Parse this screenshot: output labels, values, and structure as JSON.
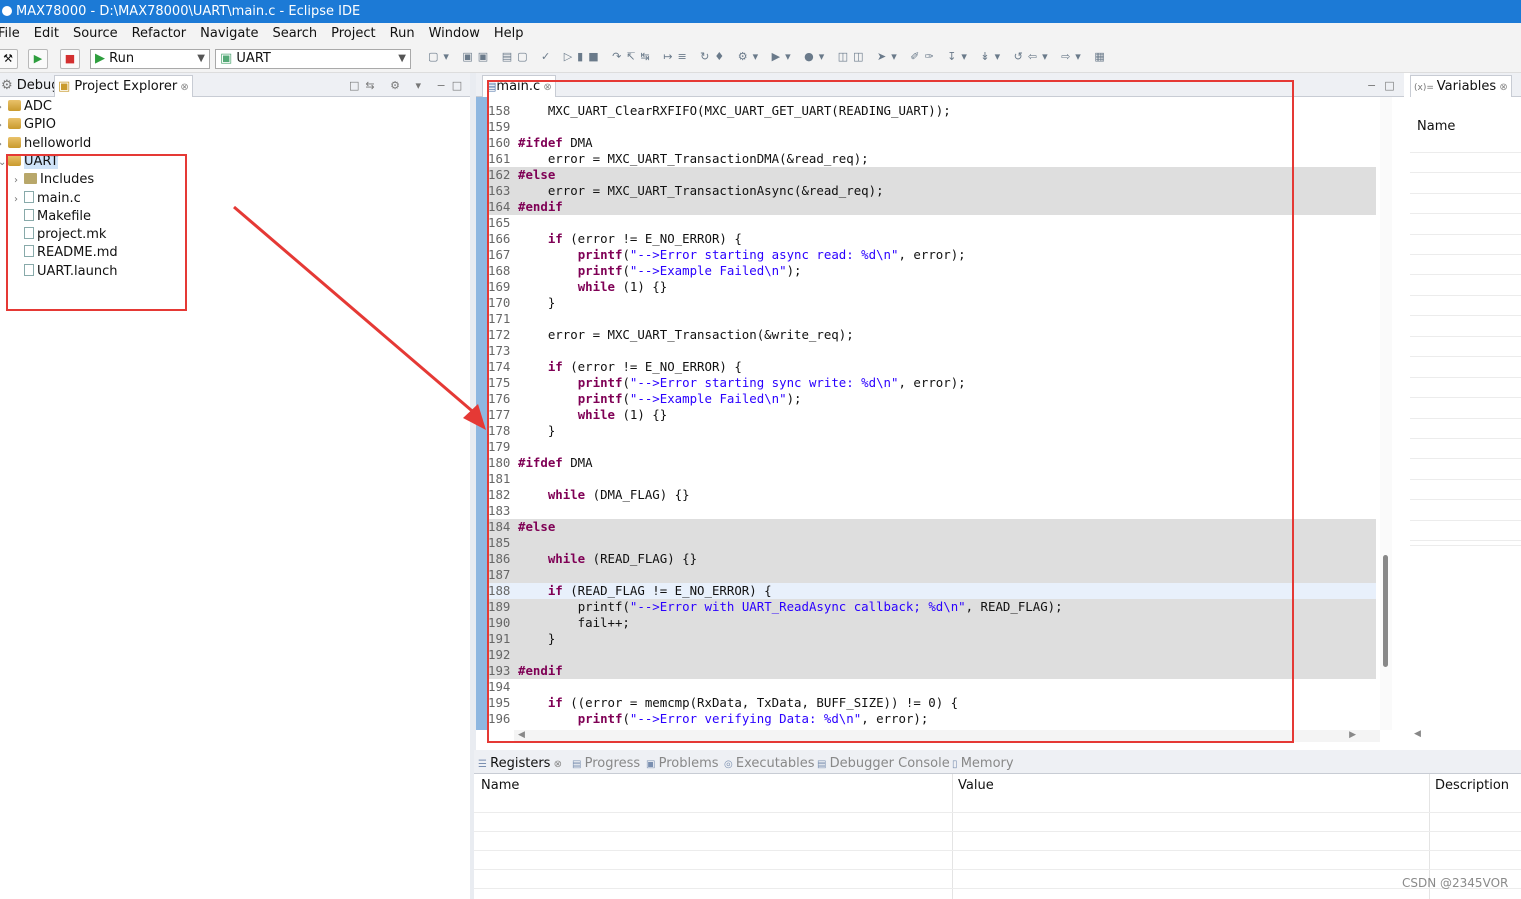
{
  "window": {
    "title": "MAX78000 - D:\\MAX78000\\UART\\main.c - Eclipse IDE"
  },
  "menu": [
    "File",
    "Edit",
    "Source",
    "Refactor",
    "Navigate",
    "Search",
    "Project",
    "Run",
    "Window",
    "Help"
  ],
  "toolbar": {
    "launch_mode": "Run",
    "launch_config": "UART"
  },
  "left_tabs": {
    "debug": "Debug",
    "project_explorer": "Project Explorer"
  },
  "tree": [
    {
      "label": "ADC",
      "icon": "project-folder-icon",
      "expanded": false
    },
    {
      "label": "GPIO",
      "icon": "project-folder-icon",
      "expanded": false
    },
    {
      "label": "helloworld",
      "icon": "project-folder-icon",
      "expanded": false
    },
    {
      "label": "UART",
      "icon": "project-folder-icon",
      "expanded": true,
      "selected": true
    },
    {
      "label": "Includes",
      "icon": "includes-icon",
      "child": true
    },
    {
      "label": "main.c",
      "icon": "c-file-icon",
      "child": true
    },
    {
      "label": "Makefile",
      "icon": "makefile-icon",
      "child": true
    },
    {
      "label": "project.mk",
      "icon": "file-icon",
      "child": true
    },
    {
      "label": "README.md",
      "icon": "file-icon",
      "child": true
    },
    {
      "label": "UART.launch",
      "icon": "file-icon",
      "child": true
    }
  ],
  "editor": {
    "tab": "main.c",
    "lines": [
      {
        "n": "158",
        "bg": "",
        "text": "    MXC_UART_ClearRXFIFO(MXC_UART_GET_UART(READING_UART));"
      },
      {
        "n": "159",
        "bg": "",
        "text": ""
      },
      {
        "n": "160",
        "bg": "",
        "text": "#ifdef DMA",
        "pre": "#ifdef",
        "rest": " DMA"
      },
      {
        "n": "161",
        "bg": "",
        "text": "    error = MXC_UART_TransactionDMA(&read_req);"
      },
      {
        "n": "162",
        "bg": "grey",
        "text": "#else",
        "pre": "#else",
        "rest": ""
      },
      {
        "n": "163",
        "bg": "grey",
        "text": "    error = MXC_UART_TransactionAsync(&read_req);"
      },
      {
        "n": "164",
        "bg": "grey",
        "text": "#endif",
        "pre": "#endif",
        "rest": ""
      },
      {
        "n": "165",
        "bg": "",
        "text": ""
      },
      {
        "n": "166",
        "bg": "",
        "text": "    if (error != E_NO_ERROR) {",
        "kw": "if",
        "indent": "    ",
        "rest": " (error != E_NO_ERROR) {"
      },
      {
        "n": "167",
        "bg": "",
        "kind": "printf",
        "indent": "        ",
        "fn": "printf",
        "str": "\"-->Error starting async read: %d\\n\"",
        "rest": ", error);",
        "text": "        printf(\"-->Error starting async read: %d\\n\", error);"
      },
      {
        "n": "168",
        "bg": "",
        "kind": "printf",
        "indent": "        ",
        "fn": "printf",
        "str": "\"-->Example Failed\\n\"",
        "rest": ");",
        "text": "        printf(\"-->Example Failed\\n\");"
      },
      {
        "n": "169",
        "bg": "",
        "text": "        while (1) {}",
        "kw": "while",
        "indent": "        ",
        "rest": " (1) {}"
      },
      {
        "n": "170",
        "bg": "",
        "text": "    }"
      },
      {
        "n": "171",
        "bg": "",
        "text": ""
      },
      {
        "n": "172",
        "bg": "",
        "text": "    error = MXC_UART_Transaction(&write_req);"
      },
      {
        "n": "173",
        "bg": "",
        "text": ""
      },
      {
        "n": "174",
        "bg": "",
        "text": "    if (error != E_NO_ERROR) {",
        "kw": "if",
        "indent": "    ",
        "rest": " (error != E_NO_ERROR) {"
      },
      {
        "n": "175",
        "bg": "",
        "kind": "printf",
        "indent": "        ",
        "fn": "printf",
        "str": "\"-->Error starting sync write: %d\\n\"",
        "rest": ", error);",
        "text": "        printf(\"-->Error starting sync write: %d\\n\", error);"
      },
      {
        "n": "176",
        "bg": "",
        "kind": "printf",
        "indent": "        ",
        "fn": "printf",
        "str": "\"-->Example Failed\\n\"",
        "rest": ");",
        "text": "        printf(\"-->Example Failed\\n\");"
      },
      {
        "n": "177",
        "bg": "",
        "text": "        while (1) {}",
        "kw": "while",
        "indent": "        ",
        "rest": " (1) {}"
      },
      {
        "n": "178",
        "bg": "",
        "text": "    }"
      },
      {
        "n": "179",
        "bg": "",
        "text": ""
      },
      {
        "n": "180",
        "bg": "",
        "text": "#ifdef DMA",
        "pre": "#ifdef",
        "rest": " DMA"
      },
      {
        "n": "181",
        "bg": "",
        "text": ""
      },
      {
        "n": "182",
        "bg": "",
        "text": "    while (DMA_FLAG) {}",
        "kw": "while",
        "indent": "    ",
        "rest": " (DMA_FLAG) {}"
      },
      {
        "n": "183",
        "bg": "",
        "text": ""
      },
      {
        "n": "184",
        "bg": "grey",
        "text": "#else",
        "pre": "#else",
        "rest": ""
      },
      {
        "n": "185",
        "bg": "grey",
        "text": ""
      },
      {
        "n": "186",
        "bg": "grey",
        "text": "    while (READ_FLAG) {}",
        "kw": "while",
        "indent": "    ",
        "rest": " (READ_FLAG) {}"
      },
      {
        "n": "187",
        "bg": "grey",
        "text": ""
      },
      {
        "n": "188",
        "bg": "hl",
        "text": "    if (READ_FLAG != E_NO_ERROR) {",
        "kw": "if",
        "indent": "    ",
        "rest": " (READ_FLAG != E_NO_ERROR) {"
      },
      {
        "n": "189",
        "bg": "grey",
        "kind": "printf",
        "plainfn": true,
        "indent": "        ",
        "fn": "printf",
        "str": "\"-->Error with UART_ReadAsync callback; %d\\n\"",
        "rest": ", READ_FLAG);",
        "text": "        printf(\"-->Error with UART_ReadAsync callback; %d\\n\", READ_FLAG);"
      },
      {
        "n": "190",
        "bg": "grey",
        "text": "        fail++;"
      },
      {
        "n": "191",
        "bg": "grey",
        "text": "    }"
      },
      {
        "n": "192",
        "bg": "grey",
        "text": ""
      },
      {
        "n": "193",
        "bg": "grey",
        "text": "#endif",
        "pre": "#endif",
        "rest": ""
      },
      {
        "n": "194",
        "bg": "",
        "text": ""
      },
      {
        "n": "195",
        "bg": "",
        "text": "    if ((error = memcmp(RxData, TxData, BUFF_SIZE)) != 0) {",
        "kw": "if",
        "indent": "    ",
        "rest": " ((error = memcmp(RxData, TxData, BUFF_SIZE)) != 0) {"
      },
      {
        "n": "196",
        "bg": "",
        "kind": "printf",
        "indent": "        ",
        "fn": "printf",
        "str": "\"-->Error verifying Data: %d\\n\"",
        "rest": ", error);",
        "text": "        printf(\"-->Error verifying Data: %d\\n\", error);"
      }
    ]
  },
  "variables": {
    "tab": "Variables",
    "column": "Name"
  },
  "bottom": {
    "tabs": [
      "Registers",
      "Progress",
      "Problems",
      "Executables",
      "Debugger Console",
      "Memory"
    ],
    "columns": [
      "Name",
      "Value",
      "Description"
    ]
  },
  "watermark": "CSDN @2345VOR",
  "colors": {
    "titlebar": "#1c7ad6",
    "annotation_red": "#e53935",
    "keyword": "#7f0055",
    "string": "#2a00ff"
  }
}
